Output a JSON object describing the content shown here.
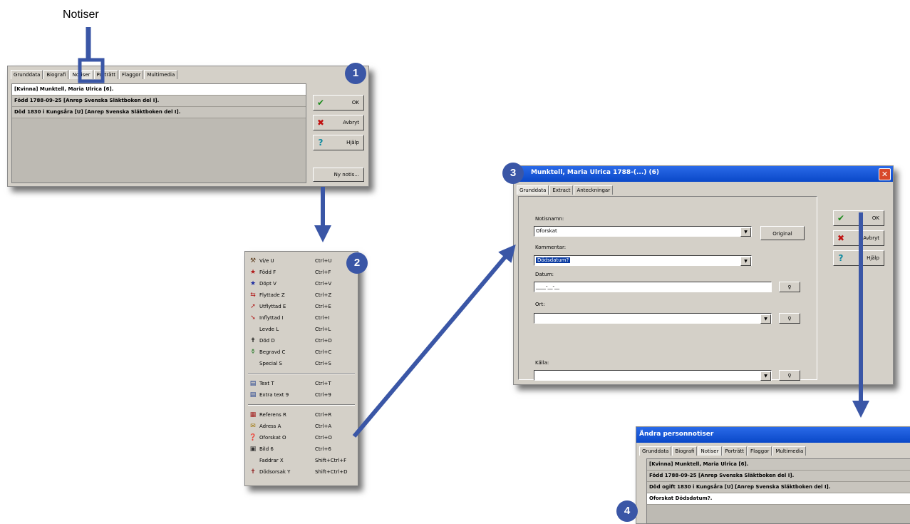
{
  "callout": {
    "label": "Notiser"
  },
  "badges": {
    "b1": "1",
    "b2": "2",
    "b3": "3",
    "b4": "4"
  },
  "tabs": [
    "Grunddata",
    "Biografi",
    "Notiser",
    "Porträtt",
    "Flaggor",
    "Multimedia"
  ],
  "panel1": {
    "rows": [
      "[Kvinna] Munktell, Maria Ulrica [6].",
      "Född 1788-09-25 [Anrep Svenska Släktboken del I].",
      "Död 1830 i Kungsåra [U] [Anrep Svenska Släktboken del I]."
    ],
    "buttons": {
      "ok": "OK",
      "cancel": "Avbryt",
      "help": "Hjälp",
      "new_note": "Ny notis..."
    }
  },
  "menu": {
    "items": [
      {
        "icon": "hammer-icon",
        "glyph": "⚒",
        "color": "#5a3a1a",
        "label": "Vi/e U",
        "shortcut": "Ctrl+U"
      },
      {
        "icon": "red-star-icon",
        "glyph": "★",
        "color": "#b01818",
        "label": "Född F",
        "shortcut": "Ctrl+F"
      },
      {
        "icon": "blue-star-icon",
        "glyph": "★",
        "color": "#1a2aa0",
        "label": "Döpt V",
        "shortcut": "Ctrl+V"
      },
      {
        "icon": "moved-icon",
        "glyph": "⇆",
        "color": "#b01818",
        "label": "Flyttade Z",
        "shortcut": "Ctrl+Z"
      },
      {
        "icon": "emigrated-icon",
        "glyph": "➚",
        "color": "#b01818",
        "label": "Utflyttad E",
        "shortcut": "Ctrl+E"
      },
      {
        "icon": "immigrated-icon",
        "glyph": "➘",
        "color": "#b01818",
        "label": "Inflyttad I",
        "shortcut": "Ctrl+I"
      },
      {
        "icon": "",
        "glyph": "",
        "color": "#000",
        "label": "Levde L",
        "shortcut": "Ctrl+L"
      },
      {
        "icon": "cross-icon",
        "glyph": "✝",
        "color": "#000000",
        "label": "Död D",
        "shortcut": "Ctrl+D"
      },
      {
        "icon": "shovel-icon",
        "glyph": "⚱",
        "color": "#2a7a2a",
        "label": "Begravd C",
        "shortcut": "Ctrl+C"
      },
      {
        "icon": "",
        "glyph": "",
        "color": "#000",
        "label": "Special S",
        "shortcut": "Ctrl+S"
      },
      {
        "icon": "text-icon",
        "glyph": "▤",
        "color": "#1a3a8a",
        "label": "Text T",
        "shortcut": "Ctrl+T"
      },
      {
        "icon": "extra-text-icon",
        "glyph": "▤",
        "color": "#1a3a8a",
        "label": "Extra text 9",
        "shortcut": "Ctrl+9"
      },
      {
        "icon": "reference-icon",
        "glyph": "▦",
        "color": "#a01818",
        "label": "Referens R",
        "shortcut": "Ctrl+R"
      },
      {
        "icon": "address-icon",
        "glyph": "✉",
        "color": "#a07a10",
        "label": "Adress A",
        "shortcut": "Ctrl+A"
      },
      {
        "icon": "unknown-icon",
        "glyph": "❓",
        "color": "#1a3a8a",
        "label": "Oforskat O",
        "shortcut": "Ctrl+O"
      },
      {
        "icon": "image-icon",
        "glyph": "▣",
        "color": "#333333",
        "label": "Bild 6",
        "shortcut": "Ctrl+6"
      },
      {
        "icon": "",
        "glyph": "",
        "color": "#000",
        "label": "Faddrar X",
        "shortcut": "Shift+Ctrl+F"
      },
      {
        "icon": "death-cause-icon",
        "glyph": "✝",
        "color": "#8a1010",
        "label": "Dödsorsak Y",
        "shortcut": "Shift+Ctrl+D"
      }
    ]
  },
  "dialog3": {
    "title": "Munktell, Maria Ulrica 1788-(...) (6)",
    "tabs": [
      "Grunddata",
      "Extract",
      "Anteckningar"
    ],
    "fields": {
      "notename_label": "Notisnamn:",
      "notename_value": "Oforskat",
      "original_btn": "Original",
      "comment_label": "Kommentar:",
      "comment_value": "Dödsdatum?",
      "date_label": "Datum:",
      "date_value": "____-__-__",
      "place_label": "Ort:",
      "place_value": "",
      "source_label": "Källa:",
      "source_value": ""
    },
    "buttons": {
      "ok": "OK",
      "cancel": "Avbryt",
      "help": "Hjälp"
    }
  },
  "panel4": {
    "title": "Ändra personnotiser",
    "rows": [
      "[Kvinna] Munktell, Maria Ulrica [6].",
      "Född 1788-09-25 [Anrep Svenska Släktboken del I].",
      "Död ogift 1830 i Kungsåra [U] [Anrep Svenska Släktboken del I].",
      "Oforskat Dödsdatum?."
    ]
  },
  "colors": {
    "accent": "#3a56a6",
    "title_bar": "#0a4fd8",
    "window": "#d4d0c8"
  }
}
